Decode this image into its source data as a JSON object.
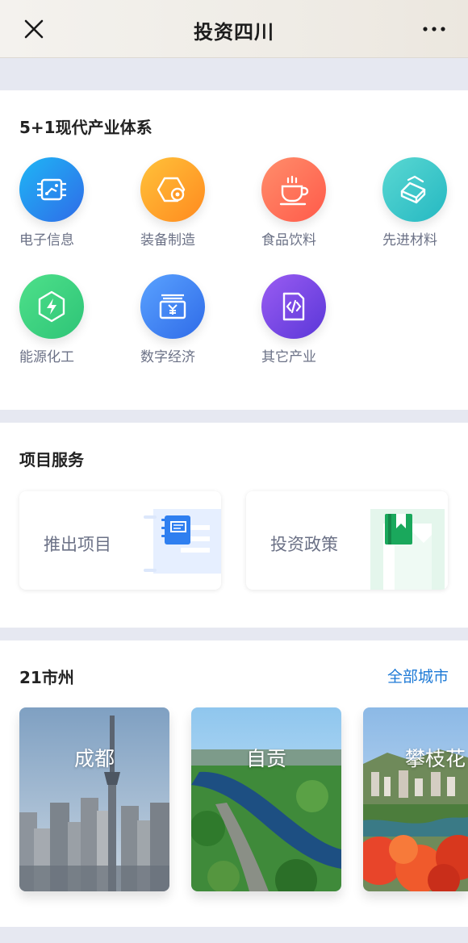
{
  "nav": {
    "title": "投资四川",
    "close_icon": "close-icon",
    "more_icon": "more-dots-icon"
  },
  "industry": {
    "title": "5+1现代产业体系",
    "items": [
      {
        "label": "电子信息",
        "icon": "chip-icon",
        "colors": [
          "#1fb6f5",
          "#2f6be8"
        ]
      },
      {
        "label": "装备制造",
        "icon": "gear-hexagon-icon",
        "colors": [
          "#ffc23a",
          "#ff8a1f"
        ]
      },
      {
        "label": "食品饮料",
        "icon": "coffee-cup-icon",
        "colors": [
          "#ff8e6b",
          "#ff5a4a"
        ]
      },
      {
        "label": "先进材料",
        "icon": "ingot-icon",
        "colors": [
          "#5ad8d2",
          "#25b8c2"
        ]
      },
      {
        "label": "能源化工",
        "icon": "energy-bolt-icon",
        "colors": [
          "#4ee08a",
          "#2ec477"
        ]
      },
      {
        "label": "数字经济",
        "icon": "yuan-wallet-icon",
        "colors": [
          "#5aa2ff",
          "#2f6be8"
        ]
      },
      {
        "label": "其它产业",
        "icon": "code-document-icon",
        "colors": [
          "#9a5cf2",
          "#5a37d8"
        ]
      }
    ]
  },
  "services": {
    "title": "项目服务",
    "items": [
      {
        "label": "推出项目",
        "icon": "notebook-icon",
        "color": "#2f7ff0"
      },
      {
        "label": "投资政策",
        "icon": "bookmark-book-icon",
        "color": "#1aa85c"
      }
    ]
  },
  "cities": {
    "title": "21市州",
    "more_label": "全部城市",
    "items": [
      {
        "name": "成都"
      },
      {
        "name": "自贡"
      },
      {
        "name": "攀枝花"
      }
    ]
  }
}
